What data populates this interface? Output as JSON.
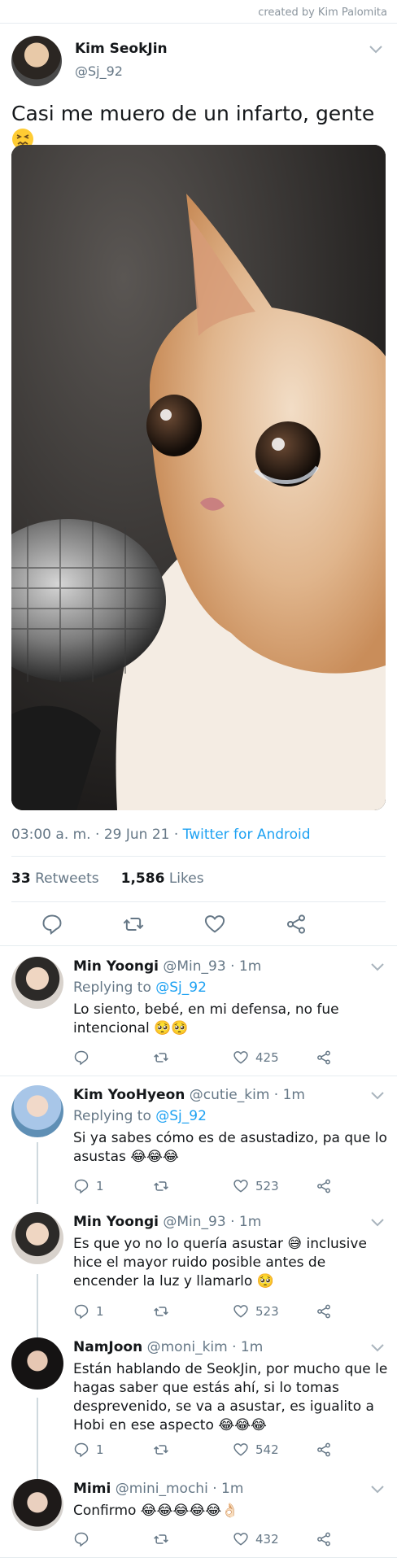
{
  "credit": "created by Kim Palomita",
  "tweet": {
    "name": "Kim SeokJin",
    "handle": "@Sj_92",
    "text": "Casi me muero de un infarto, gente",
    "text_emoji": "confounded-face",
    "time": "03:00 a. m.",
    "date": "29 Jun 21",
    "source": "Twitter for Android",
    "retweets_count": "33",
    "retweets_label": "Retweets",
    "likes_count": "1,586",
    "likes_label": "Likes",
    "image_description_icon": "crying-cat-microphone"
  },
  "replies": [
    {
      "name": "Min Yoongi",
      "handle": "@Min_93",
      "time": "1m",
      "replying_prefix": "Replying to",
      "replying_to": "@Sj_92",
      "text": "Lo siento, bebé, en mi defensa, no fue intencional 🥺🥺",
      "reply_count": "",
      "like_count": "425"
    },
    {
      "name": "Kim YooHyeon",
      "handle": "@cutie_kim",
      "time": "1m",
      "replying_prefix": "Replying to",
      "replying_to": "@Sj_92",
      "text": "Si ya sabes cómo es de asustadizo, pa que lo asustas 😂😂😂",
      "reply_count": "1",
      "like_count": "523"
    },
    {
      "name": "Min Yoongi",
      "handle": "@Min_93",
      "time": "1m",
      "text": "Es que yo no lo quería asustar 😅 inclusive hice el mayor ruido posible antes de encender la luz y llamarlo 🥺",
      "reply_count": "1",
      "like_count": "523"
    },
    {
      "name": "NamJoon",
      "handle": "@moni_kim",
      "time": "1m",
      "text": "Están hablando de SeokJin, por mucho que le hagas saber que estás ahí, si lo tomas desprevenido, se va a asustar, es igualito a Hobi en ese aspecto 😂😂😂",
      "reply_count": "1",
      "like_count": "542"
    },
    {
      "name": "Mimi",
      "handle": "@mini_mochi",
      "time": "1m",
      "text": "Confirmo 😂😂😂😂😂👌🏻",
      "reply_count": "",
      "like_count": "432"
    }
  ],
  "colors": {
    "accent": "#1da1f2",
    "muted": "#657786",
    "text": "#14171a",
    "border": "#e6ecf0"
  }
}
